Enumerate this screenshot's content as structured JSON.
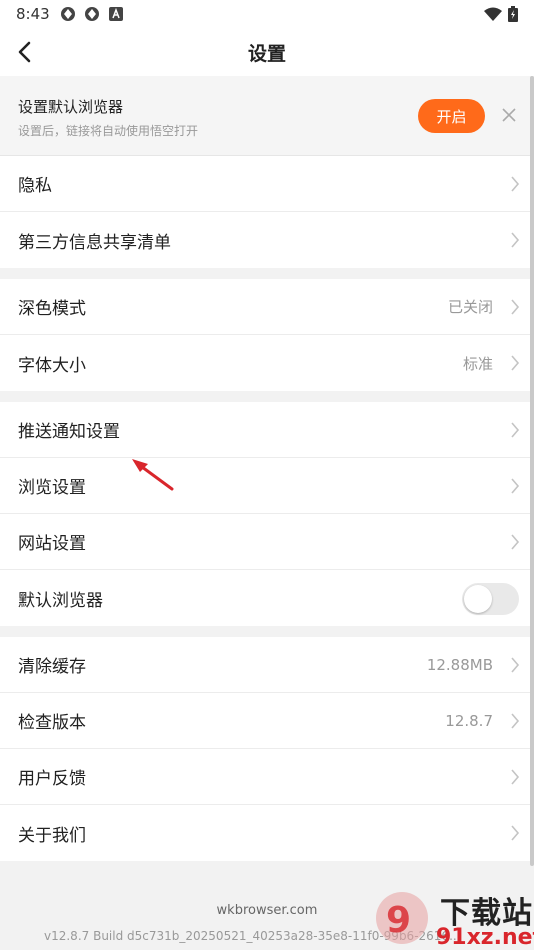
{
  "status": {
    "time": "8:43"
  },
  "header": {
    "title": "设置"
  },
  "banner": {
    "title": "设置默认浏览器",
    "subtitle": "设置后，链接将自动使用悟空打开",
    "button": "开启"
  },
  "group1": [
    {
      "label": "隐私",
      "value": ""
    },
    {
      "label": "第三方信息共享清单",
      "value": ""
    }
  ],
  "group2": [
    {
      "label": "深色模式",
      "value": "已关闭"
    },
    {
      "label": "字体大小",
      "value": "标准"
    }
  ],
  "group3": [
    {
      "label": "推送通知设置",
      "value": ""
    },
    {
      "label": "浏览设置",
      "value": ""
    },
    {
      "label": "网站设置",
      "value": ""
    },
    {
      "label": "默认浏览器",
      "value": "",
      "toggle": false
    }
  ],
  "group4": [
    {
      "label": "清除缓存",
      "value": "12.88MB"
    },
    {
      "label": "检查版本",
      "value": "12.8.7"
    },
    {
      "label": "用户反馈",
      "value": ""
    },
    {
      "label": "关于我们",
      "value": ""
    }
  ],
  "footer": {
    "site": "wkbrowser.com",
    "build": "v12.8.7 Build d5c731b_20250521_40253a28-35e8-11f0-99b6-2616..."
  },
  "watermark": {
    "line1": "下载站",
    "line2": "91xz.net"
  },
  "colors": {
    "accent": "#ff6a1a",
    "arrow": "#d9262c"
  }
}
